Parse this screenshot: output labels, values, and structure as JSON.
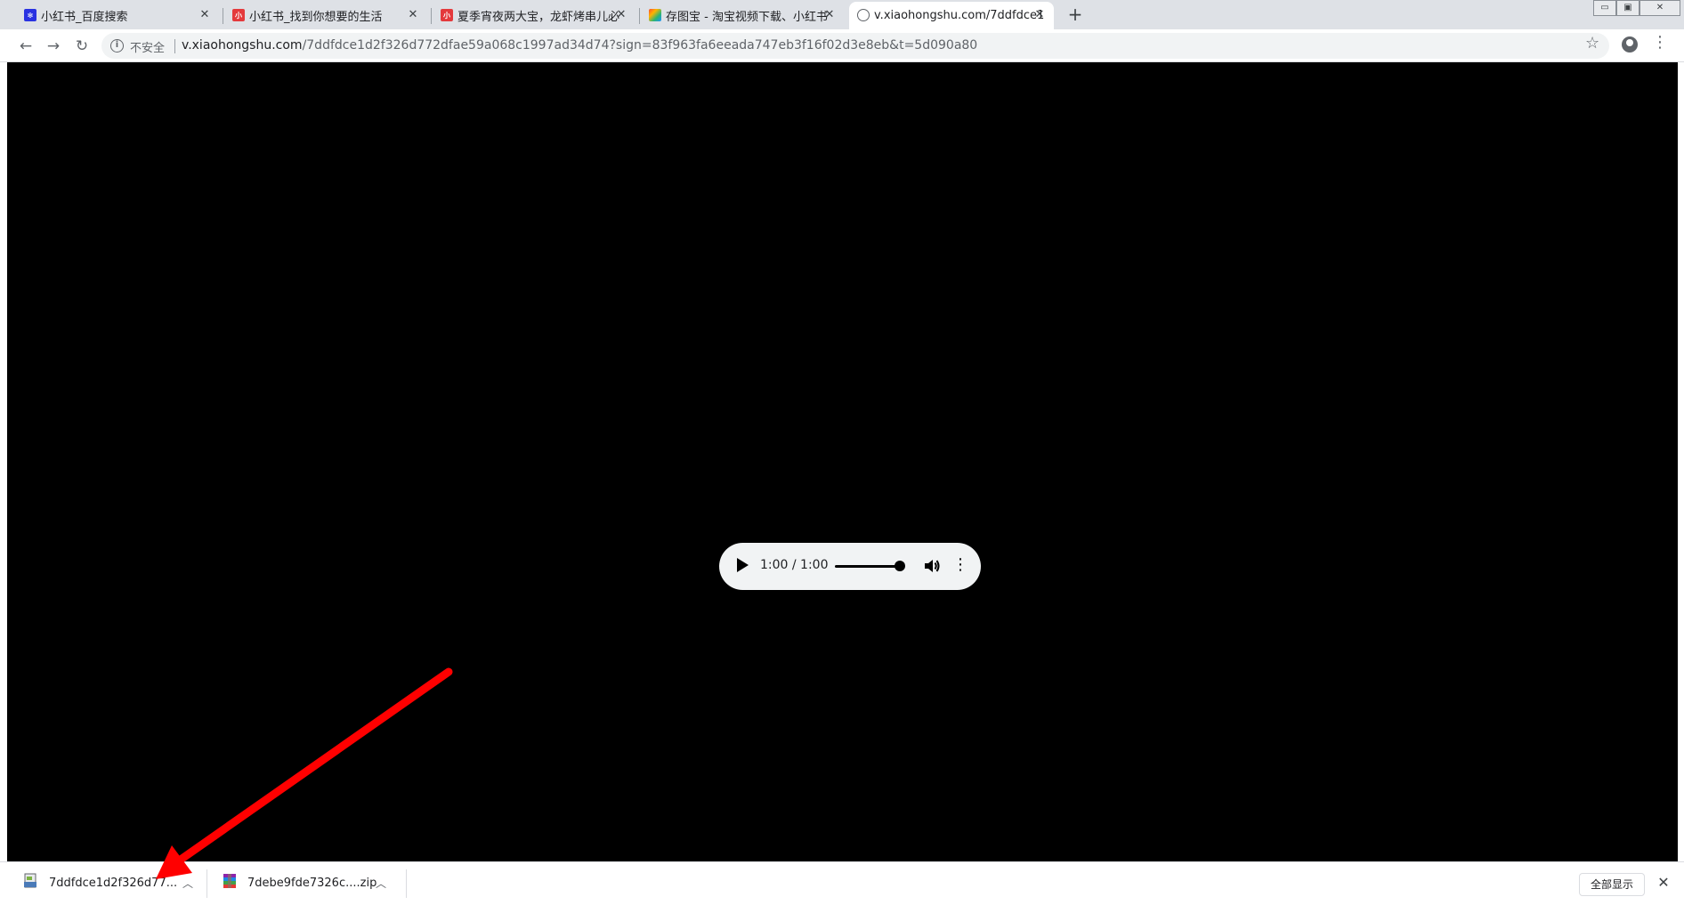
{
  "tabs": [
    {
      "title": "小红书_百度搜索",
      "favicon": "baidu-paw-icon",
      "favicon_color": "#2932e1"
    },
    {
      "title": "小红书_找到你想要的生活",
      "favicon": "xiaohongshu-icon",
      "favicon_color": "#e4393c"
    },
    {
      "title": "夏季宵夜两大宝，龙虾烤串儿必",
      "favicon": "xiaohongshu-icon",
      "favicon_color": "#e4393c"
    },
    {
      "title": "存图宝 - 淘宝视频下载、小红书",
      "favicon": "cuntubao-icon",
      "favicon_color": "#ff6a00"
    },
    {
      "title": "v.xiaohongshu.com/7ddfdce1",
      "favicon": "globe-icon",
      "favicon_color": "#5f6368"
    }
  ],
  "window_controls": {
    "minimize": "▭",
    "restore": "▣",
    "close": "✕"
  },
  "omnibox": {
    "security_label": "不安全",
    "url_host": "v.xiaohongshu.com",
    "url_rest": "/7ddfdce1d2f326d772dfae59a068c1997ad34d74?sign=83f963fa6eeada747eb3f16f02d3e8eb&t=5d090a80"
  },
  "player": {
    "time": "1:00 / 1:00",
    "progress_fraction": 1.0
  },
  "downloads": [
    {
      "name": "7ddfdce1d2f326d77...",
      "icon": "file-icon"
    },
    {
      "name": "7debe9fde7326c....zip",
      "icon": "winrar-archive-icon"
    }
  ],
  "download_bar": {
    "show_all_label": "全部显示",
    "close": "✕"
  },
  "annotation": {
    "arrow_color": "#ff0000"
  }
}
